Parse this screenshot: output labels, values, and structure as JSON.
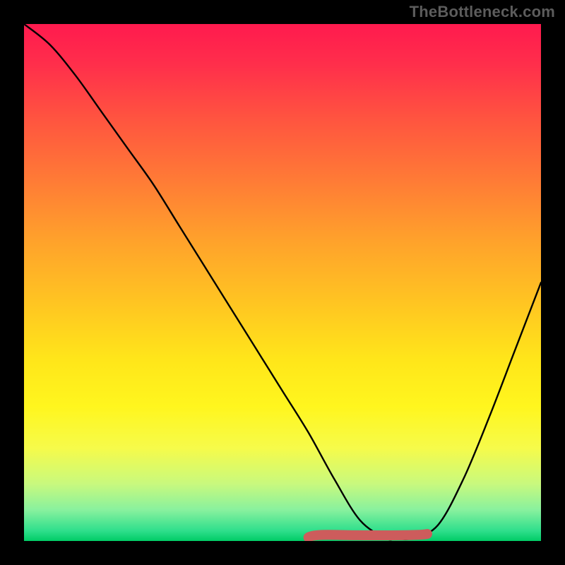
{
  "attribution": "TheBottleneck.com",
  "chart_data": {
    "type": "line",
    "title": "",
    "xlabel": "",
    "ylabel": "",
    "ylim": [
      0,
      100
    ],
    "xlim": [
      0,
      100
    ],
    "x": [
      0,
      5,
      10,
      15,
      20,
      25,
      30,
      35,
      40,
      45,
      50,
      55,
      60,
      65,
      70,
      72,
      75,
      80,
      85,
      90,
      95,
      100
    ],
    "values": [
      100,
      96,
      90,
      83,
      76,
      69,
      61,
      53,
      45,
      37,
      29,
      21,
      12,
      4,
      0.5,
      0.5,
      0.5,
      3,
      12,
      24,
      37,
      50
    ],
    "bottom_band": {
      "start_x": 55,
      "end_x": 78,
      "color": "#cd5c5c"
    },
    "gradient_stops": [
      {
        "pos": 0,
        "color": "#ff1a4e"
      },
      {
        "pos": 30,
        "color": "#ff7a36"
      },
      {
        "pos": 55,
        "color": "#ffc821"
      },
      {
        "pos": 74,
        "color": "#fff61e"
      },
      {
        "pos": 100,
        "color": "#00cc66"
      }
    ]
  }
}
